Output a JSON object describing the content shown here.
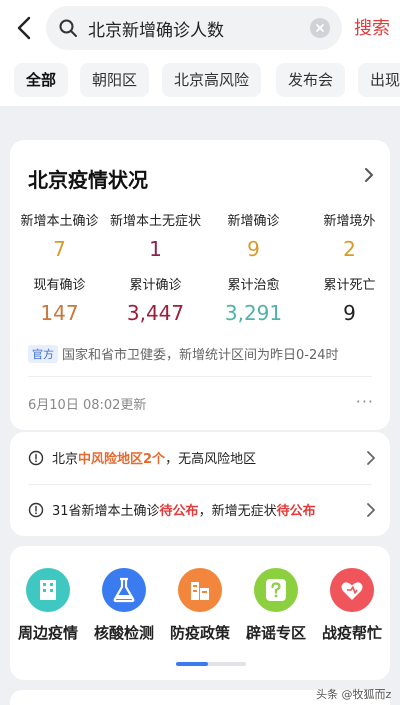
{
  "header": {
    "search_value": "北京新增确诊人数",
    "search_button": "搜索"
  },
  "tabs": [
    {
      "label": "全部",
      "active": true
    },
    {
      "label": "朝阳区"
    },
    {
      "label": "北京高风险"
    },
    {
      "label": "发布会"
    },
    {
      "label": "出现"
    }
  ],
  "covid_card": {
    "title": "北京疫情状况",
    "stats_row1": [
      {
        "label": "新增本土确诊",
        "value": "7",
        "color": "#d99a2c"
      },
      {
        "label": "新增本土无症状",
        "value": "1",
        "color": "#8b1f56"
      },
      {
        "label": "新增确诊",
        "value": "9",
        "color": "#d99a2c"
      },
      {
        "label": "新增境外",
        "value": "2",
        "color": "#d99a2c"
      }
    ],
    "stats_row2": [
      {
        "label": "现有确诊",
        "value": "147",
        "color": "#c9773a"
      },
      {
        "label": "累计确诊",
        "value": "3,447",
        "color": "#9c1f3a"
      },
      {
        "label": "累计治愈",
        "value": "3,291",
        "color": "#4fb3a9"
      },
      {
        "label": "累计死亡",
        "value": "9",
        "color": "#222222"
      }
    ],
    "official_badge": "官方",
    "official_text": "国家和省市卫健委，新增统计区间为昨日0-24时",
    "updated": "6月10日 08:02更新",
    "more": "···"
  },
  "notices": [
    {
      "pre": "北京",
      "highlight": "中风险地区2个",
      "post": "，无高风险地区",
      "highlight_color": "#e8692e"
    },
    {
      "pre": "31省新增本土确诊",
      "highlight": "待公布",
      "mid": "，新增无症状",
      "highlight2": "待公布",
      "highlight_color": "#e33b3b"
    }
  ],
  "services": [
    {
      "label": "周边疫情",
      "icon": "building-icon",
      "color": "#3fc7c2"
    },
    {
      "label": "核酸检测",
      "icon": "flask-icon",
      "color": "#3a7bf0"
    },
    {
      "label": "防疫政策",
      "icon": "policy-building-icon",
      "color": "#f2863c"
    },
    {
      "label": "辟谣专区",
      "icon": "question-icon",
      "color": "#8ccf3f"
    },
    {
      "label": "战疫帮忙",
      "icon": "heart-icon",
      "color": "#f0555b"
    }
  ],
  "watermark": "头条 @牧狐而z"
}
